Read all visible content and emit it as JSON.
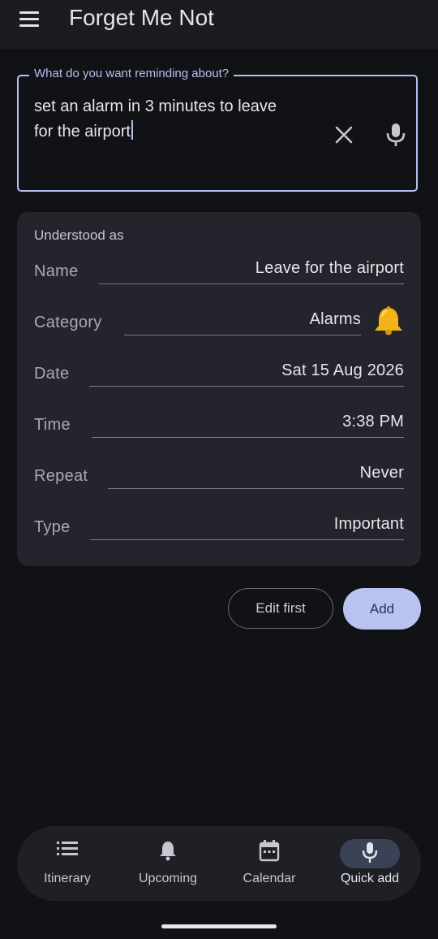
{
  "app": {
    "title": "Forget Me Not"
  },
  "reminder_input": {
    "label": "What do you want reminding about?",
    "value_line1": "set an alarm in 3 minutes to leave",
    "value_line2": "for the airport"
  },
  "understood": {
    "title": "Understood as",
    "fields": [
      {
        "label": "Name",
        "value": "Leave for the airport"
      },
      {
        "label": "Category",
        "value": "Alarms",
        "icon": "bell-icon"
      },
      {
        "label": "Date",
        "value": "Sat 15 Aug 2026"
      },
      {
        "label": "Time",
        "value": "3:38 PM"
      },
      {
        "label": "Repeat",
        "value": "Never"
      },
      {
        "label": "Type",
        "value": "Important"
      }
    ]
  },
  "actions": {
    "edit_label": "Edit first",
    "add_label": "Add"
  },
  "nav": {
    "items": [
      {
        "label": "Itinerary",
        "icon": "list-icon"
      },
      {
        "label": "Upcoming",
        "icon": "bell-icon"
      },
      {
        "label": "Calendar",
        "icon": "calendar-icon"
      },
      {
        "label": "Quick add",
        "icon": "mic-icon",
        "selected": true
      }
    ]
  },
  "colors": {
    "accent": "#b4c0ee",
    "add_button": "#b8c3ef",
    "background": "#111216",
    "card": "#23242c",
    "bell": "#f2b318"
  }
}
